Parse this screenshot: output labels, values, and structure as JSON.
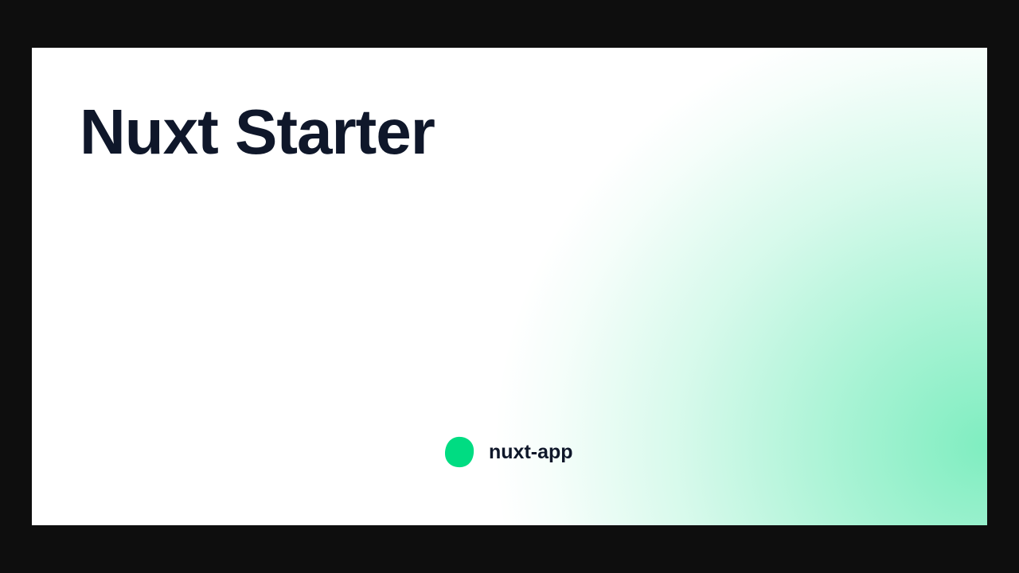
{
  "card": {
    "title": "Nuxt Starter",
    "brand": {
      "name": "nuxt-app",
      "icon": "green-blob-icon"
    }
  },
  "colors": {
    "outer_background": "#0e0e0e",
    "card_background": "#ffffff",
    "text": "#0f172a",
    "accent": "#00dc82"
  }
}
